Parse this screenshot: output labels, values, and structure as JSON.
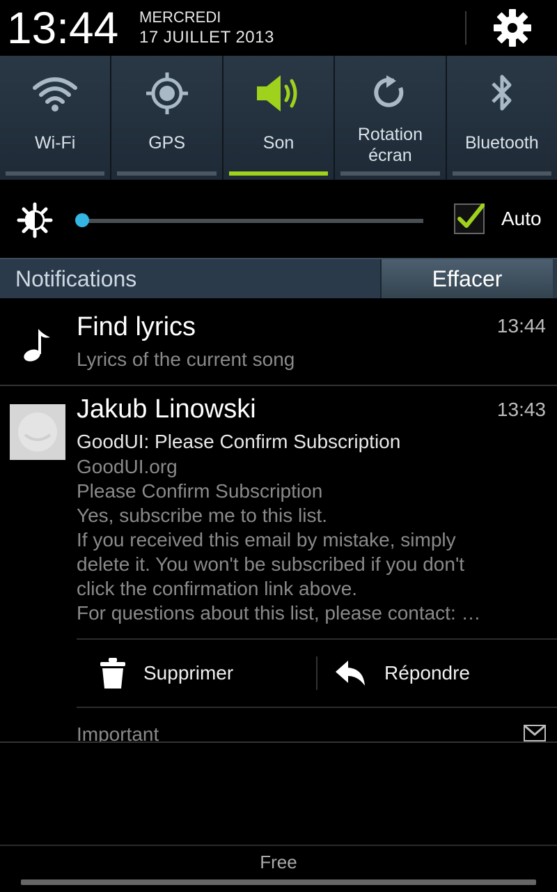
{
  "status": {
    "time": "13:44",
    "day": "MERCREDI",
    "date": "17 JUILLET 2013",
    "settings_icon": "gear-icon"
  },
  "toggles": [
    {
      "label": "Wi-Fi",
      "icon": "wifi-icon",
      "active": false
    },
    {
      "label": "GPS",
      "icon": "gps-icon",
      "active": false
    },
    {
      "label": "Son",
      "icon": "speaker-icon",
      "active": true
    },
    {
      "label_line1": "Rotation",
      "label_line2": "écran",
      "icon": "rotate-icon",
      "active": false
    },
    {
      "label": "Bluetooth",
      "icon": "bluetooth-icon",
      "active": false
    }
  ],
  "brightness": {
    "level_fraction": 0.0,
    "auto_label": "Auto",
    "auto_checked": true
  },
  "notifications_bar": {
    "title": "Notifications",
    "clear_label": "Effacer"
  },
  "notifications": [
    {
      "title": "Find lyrics",
      "subtitle": "Lyrics of the current song",
      "time": "13:44",
      "icon": "music-note-icon"
    },
    {
      "title": "Jakub Linowski",
      "time": "13:43",
      "subject": "GoodUI: Please Confirm Subscription",
      "body": [
        "GoodUI.org",
        "Please Confirm Subscription",
        "Yes, subscribe me to this list.",
        "If you received this email by mistake, simply",
        "delete it. You won't be subscribed if you don't",
        "click the confirmation link above.",
        "For questions about this list, please contact: …"
      ],
      "actions": {
        "delete_label": "Supprimer",
        "reply_label": "Répondre"
      },
      "label": "Important"
    }
  ],
  "carrier": "Free",
  "colors": {
    "accent_active": "#9fd21c",
    "slider_thumb": "#34b6e4",
    "toggle_bg": "#2a3846"
  }
}
